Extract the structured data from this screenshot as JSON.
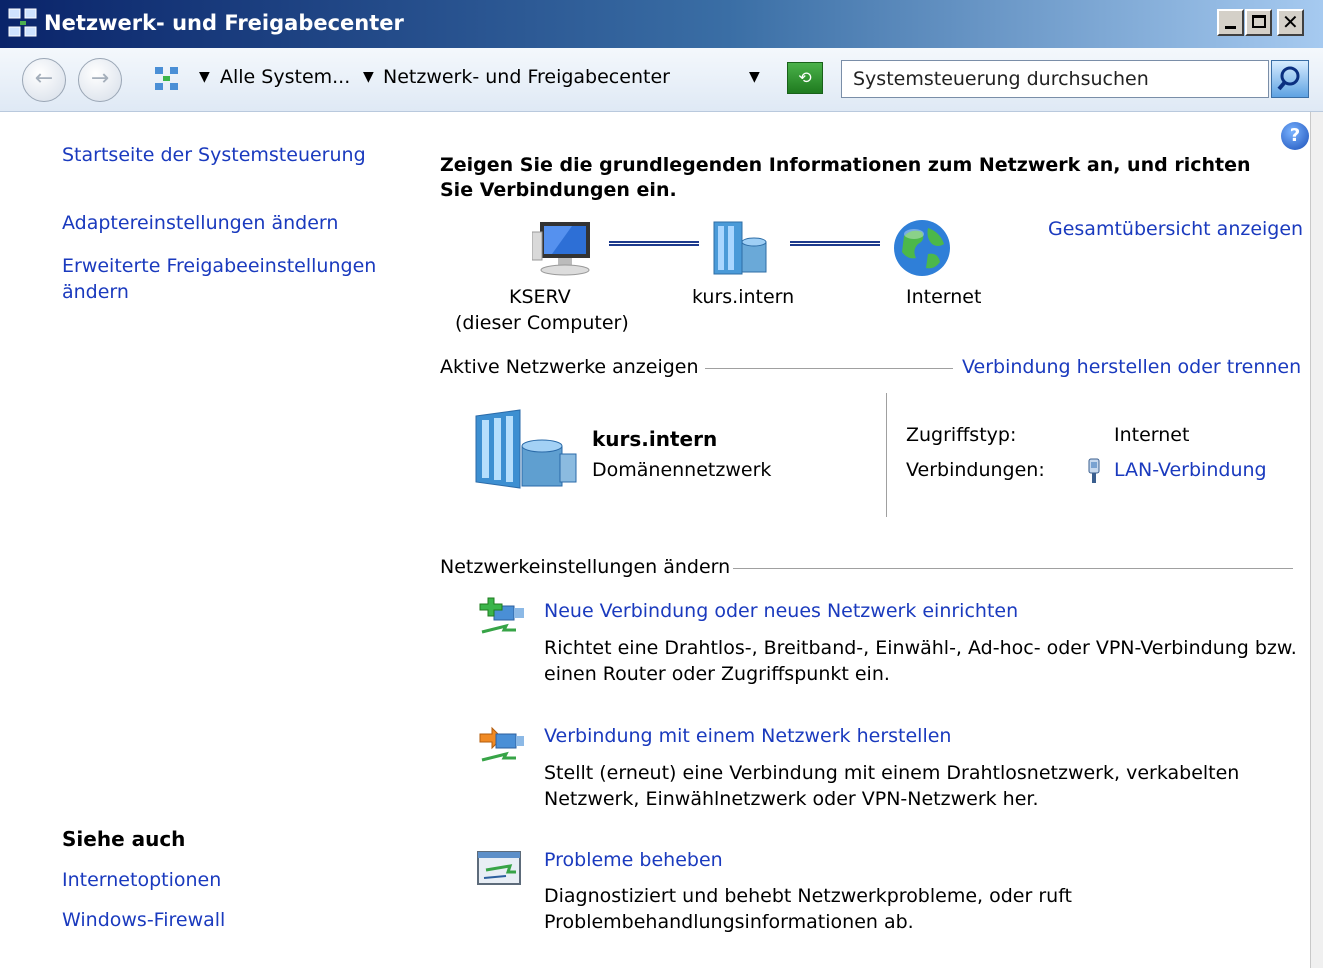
{
  "window": {
    "title": "Netzwerk- und Freigabecenter"
  },
  "navbar": {
    "breadcrumb_1": "Alle System...",
    "breadcrumb_2": "Netzwerk- und Freigabecenter",
    "search_placeholder": "Systemsteuerung durchsuchen"
  },
  "sidebar": {
    "home_link": "Startseite der Systemsteuerung",
    "adapter_link": "Adaptereinstellungen ändern",
    "sharing_link_line1": "Erweiterte Freigabeeinstellungen",
    "sharing_link_line2": "ändern",
    "see_also_heading": "Siehe auch",
    "internet_options": "Internetoptionen",
    "firewall": "Windows-Firewall"
  },
  "main": {
    "heading_line1": "Zeigen Sie die grundlegenden Informationen zum Netzwerk an, und richten",
    "heading_line2": "Sie Verbindungen ein.",
    "full_map_link": "Gesamtübersicht anzeigen",
    "map": {
      "computer_name": "KSERV",
      "computer_note": "(dieser Computer)",
      "network_name": "kurs.intern",
      "internet_label": "Internet"
    },
    "active_networks": {
      "section_label": "Aktive Netzwerke anzeigen",
      "connect_link": "Verbindung herstellen oder trennen",
      "network_name": "kurs.intern",
      "network_type": "Domänennetzwerk",
      "access_type_label": "Zugriffstyp:",
      "access_type_value": "Internet",
      "connections_label": "Verbindungen:",
      "connections_value": "LAN-Verbindung"
    },
    "settings": {
      "section_label": "Netzwerkeinstellungen ändern",
      "items": [
        {
          "title": "Neue Verbindung oder neues Netzwerk einrichten",
          "desc_line1": "Richtet eine Drahtlos-, Breitband-, Einwähl-, Ad-hoc- oder VPN-Verbindung bzw.",
          "desc_line2": "einen Router oder Zugriffspunkt ein."
        },
        {
          "title": "Verbindung mit einem Netzwerk herstellen",
          "desc_line1": "Stellt (erneut) eine Verbindung mit einem Drahtlosnetzwerk, verkabelten",
          "desc_line2": "Netzwerk, Einwählnetzwerk oder VPN-Netzwerk her."
        },
        {
          "title": "Probleme beheben",
          "desc_line1": "Diagnostiziert und behebt Netzwerkprobleme, oder ruft",
          "desc_line2": "Problembehandlungsinformationen ab."
        }
      ]
    }
  },
  "colors": {
    "link": "#1a3abe",
    "titlebar_start": "#0a246a",
    "titlebar_end": "#a6caf0"
  }
}
